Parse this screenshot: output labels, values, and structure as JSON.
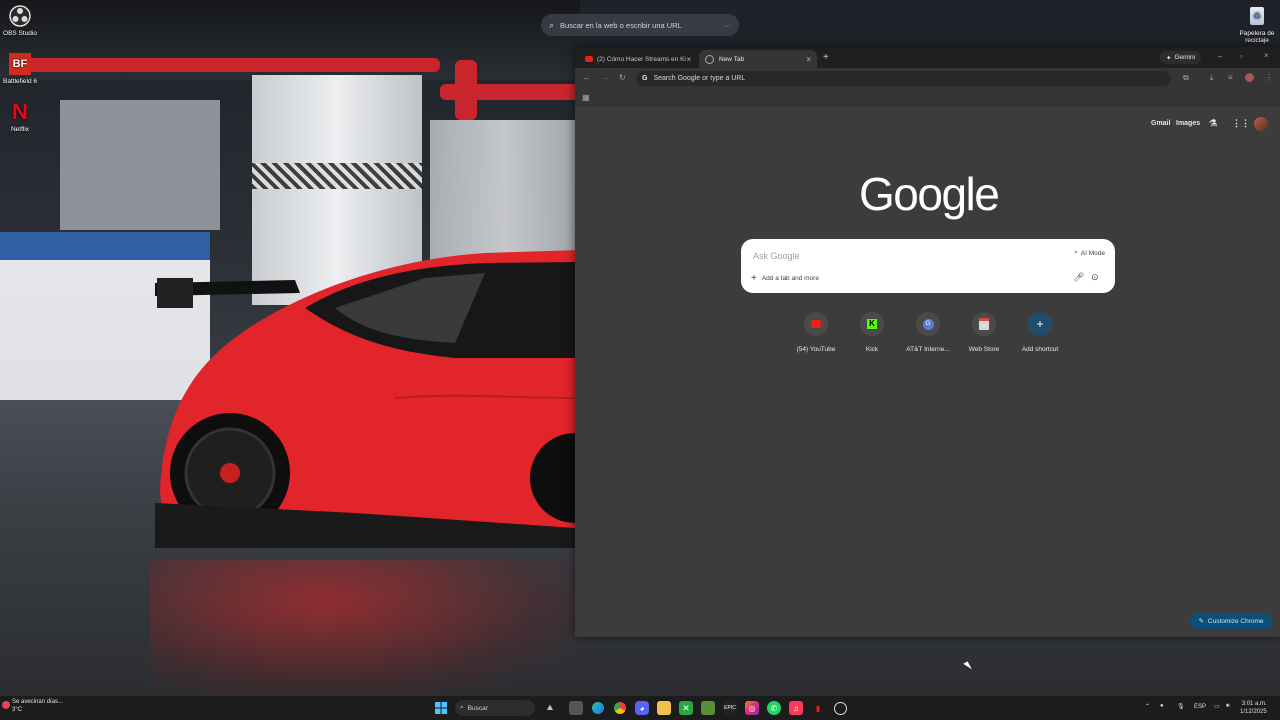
{
  "desktop": {
    "web_search_placeholder": "Buscar en la web o escribir una URL",
    "icons": [
      {
        "label": "OBS Studio",
        "icon": "obs-icon"
      },
      {
        "label": "Battlefield 6",
        "icon": "battlefield-icon"
      },
      {
        "label": "Netflix",
        "icon": "netflix-icon"
      },
      {
        "label": "Papelera de reciclaje",
        "icon": "recycle-bin-icon"
      }
    ]
  },
  "chrome": {
    "tabs": [
      {
        "title": "(2) Cómo Hacer Streams en Ki",
        "icon": "youtube-icon",
        "active": false
      },
      {
        "title": "New Tab",
        "icon": "chrome-icon",
        "active": true
      }
    ],
    "gemini_label": "Gemini",
    "omnibox_placeholder": "Search Google or type a URL",
    "ntp": {
      "links": [
        "Gmail",
        "Images"
      ],
      "logo": "Google",
      "search_placeholder": "Ask Google",
      "ai_mode_label": "AI Mode",
      "add_tab_label": "Add a tab and more",
      "shortcuts": [
        {
          "label": "(54) YouTube",
          "icon": "youtube-icon",
          "color": "#e62117"
        },
        {
          "label": "Kick",
          "icon": "kick-icon",
          "color": "#53fc18"
        },
        {
          "label": "AT&T Interne...",
          "icon": "att-icon",
          "color": "#5b7fd6"
        },
        {
          "label": "Web Store",
          "icon": "web-store-icon",
          "color": "#d9d9d9"
        },
        {
          "label": "Add shortcut",
          "icon": "plus-icon",
          "color": "#8ab4f8"
        }
      ],
      "customize_label": "Customize Chrome"
    }
  },
  "taskbar": {
    "weather_text": "Se avecinan días...",
    "weather_temp": "3°C",
    "search_label": "Buscar",
    "language": "ESP",
    "time": "3:01 a.m.",
    "date": "1/12/2025"
  }
}
